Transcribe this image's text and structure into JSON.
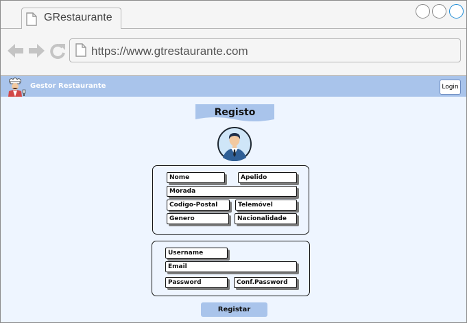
{
  "browser": {
    "tab_title": "GRestaurante",
    "url": "https://www.gtrestaurante.com",
    "icons": {
      "tab": "page-icon",
      "back": "back-arrow-icon",
      "forward": "forward-arrow-icon",
      "reload": "reload-icon",
      "address": "page-icon"
    }
  },
  "app": {
    "title": "Gestor Restaurante",
    "login_label": "Login",
    "logo_icon": "chef-icon",
    "colors": {
      "header": "#a9c4eb",
      "background": "#eef5ff",
      "button": "#a9c4eb"
    }
  },
  "form": {
    "title": "Registo",
    "avatar_icon": "user-avatar-icon",
    "personal": {
      "nome": "Nome",
      "apelido": "Apelido",
      "morada": "Morada",
      "codigo_postal": "Codigo-Postal",
      "telemovel": "Telemóvel",
      "genero": "Genero",
      "nacionalidade": "Nacionalidade"
    },
    "account": {
      "username": "Username",
      "email": "Email",
      "password": "Password",
      "conf_password": "Conf.Password"
    },
    "submit_label": "Registar"
  }
}
